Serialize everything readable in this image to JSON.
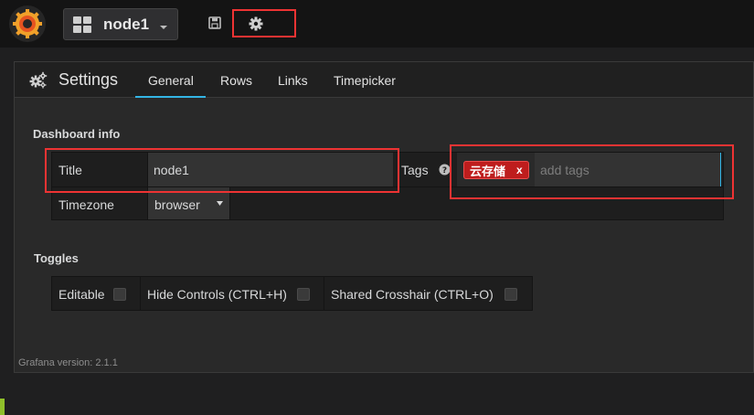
{
  "navbar": {
    "logo_icon": "grafana-logo-icon",
    "dashboard_name": "node1",
    "save_icon": "save-icon",
    "settings_icon": "gear-icon"
  },
  "settings": {
    "title": "Settings",
    "title_icon": "cogs-icon",
    "tabs": [
      {
        "label": "General",
        "active": true
      },
      {
        "label": "Rows",
        "active": false
      },
      {
        "label": "Links",
        "active": false
      },
      {
        "label": "Timepicker",
        "active": false
      }
    ]
  },
  "dashboard_info": {
    "heading": "Dashboard info",
    "title_label": "Title",
    "title_value": "node1",
    "tags_label": "Tags",
    "tags_help_icon": "question-circle-icon",
    "tags": [
      {
        "label": "云存储",
        "remove": "x"
      }
    ],
    "tags_placeholder": "add tags",
    "timezone_label": "Timezone",
    "timezone_value": "browser"
  },
  "toggles": {
    "heading": "Toggles",
    "items": [
      {
        "label": "Editable",
        "checked": false
      },
      {
        "label": "Hide Controls (CTRL+H)",
        "checked": false
      },
      {
        "label": "Shared Crosshair (CTRL+O)",
        "checked": false
      }
    ]
  },
  "footer": {
    "version": "Grafana version: 2.1.1"
  },
  "colors": {
    "accent": "#33b5e5",
    "highlight": "#ee3333",
    "tag": "#be1d1d",
    "green_marker": "#8fbf2a"
  }
}
